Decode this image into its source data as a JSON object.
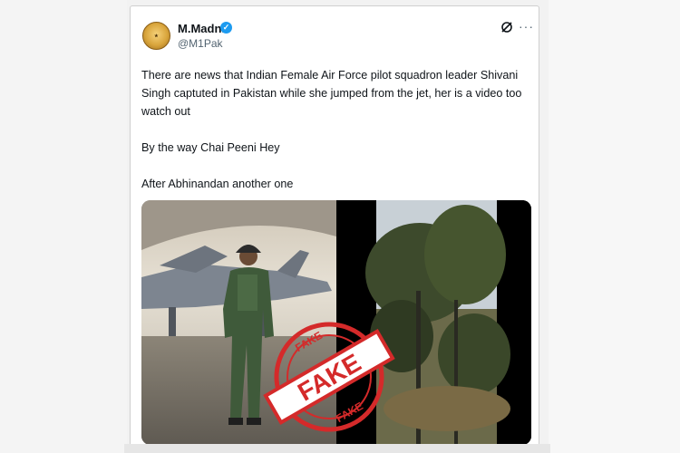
{
  "author": {
    "display_name": "M.Madni",
    "handle": "@M1Pak",
    "avatar_icon": "gold-emblem-avatar",
    "verified_icon": "verified-badge-icon",
    "verified_color": "#1d9bf0"
  },
  "header_actions": {
    "grok_icon": "grok-icon",
    "more_icon": "more-options-icon",
    "more_glyph": "···"
  },
  "tweet": {
    "paragraphs": [
      "There are news that Indian Female Air Force pilot squadron leader Shivani Singh captuted in Pakistan while she jumped from the jet, her is a video too watch out",
      "By the way Chai Peeni Hey",
      "After Abhinandan another one"
    ]
  },
  "media": {
    "left_image": "pilot-in-flight-suit-near-fighter-jet",
    "right_image": "video-frame-trees-field"
  },
  "stamp": {
    "word": "FAKE",
    "color": "#d42a2a"
  }
}
